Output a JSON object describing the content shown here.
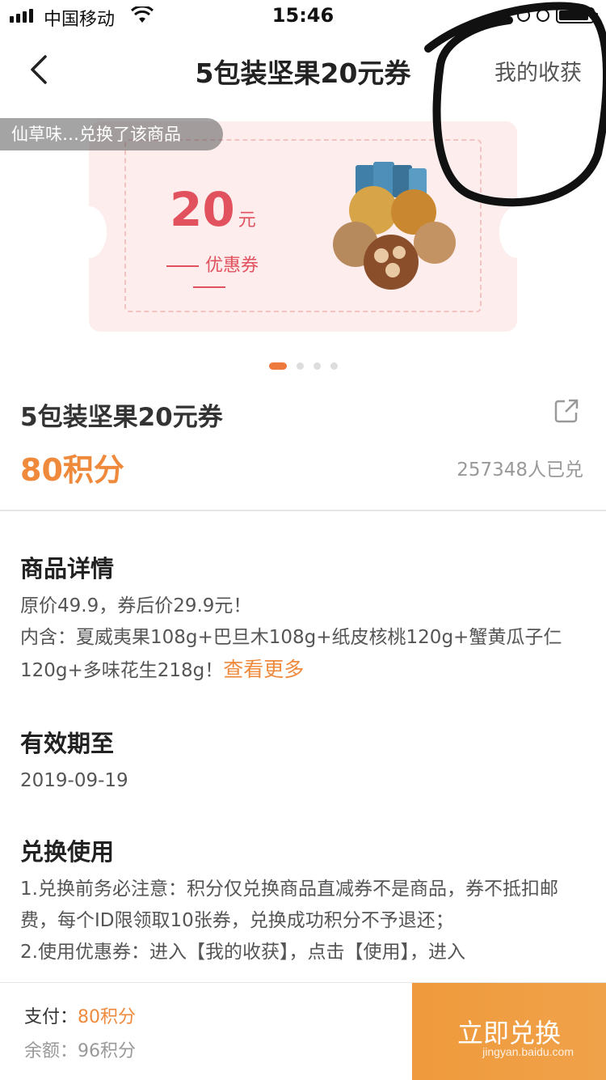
{
  "status_bar": {
    "carrier": "中国移动",
    "time": "15:46"
  },
  "nav": {
    "title": "5包装坚果20元券",
    "right_link": "我的收获"
  },
  "banner": {
    "exchanged_notice": "仙草味…兑换了该商品",
    "coupon_amount": "20",
    "coupon_unit": "元",
    "coupon_label": "优惠券",
    "page_count": 4,
    "active_page": 1
  },
  "product": {
    "title": "5包装坚果20元券",
    "points": "80积分",
    "exchanged_count": "257348人已兑"
  },
  "details": {
    "title": "商品详情",
    "line1": "原价49.9，券后价29.9元！",
    "line2": "内含：夏威夷果108g+巴旦木108g+纸皮核桃120g+蟹黄瓜子仁120g+多味花生218g！",
    "more_link": "查看更多"
  },
  "validity": {
    "title": "有效期至",
    "date": "2019-09-19"
  },
  "usage": {
    "title": "兑换使用",
    "text": "1.兑换前务必注意：积分仅兑换商品直减券不是商品，券不抵扣邮费，每个ID限领取10张券，兑换成功积分不予退还；",
    "text2": "2.使用优惠券：进入【我的收获】，点击【使用】，进入"
  },
  "bottom": {
    "pay_label": "支付：",
    "pay_value": "80积分",
    "balance_label": "余额：",
    "balance_value": "96积分",
    "redeem_button": "立即兑换"
  },
  "watermark": "jingyan.baidu.com",
  "colors": {
    "accent": "#ef8a3c",
    "coupon_red": "#e1525e",
    "coupon_bg": "#fdeeed"
  }
}
